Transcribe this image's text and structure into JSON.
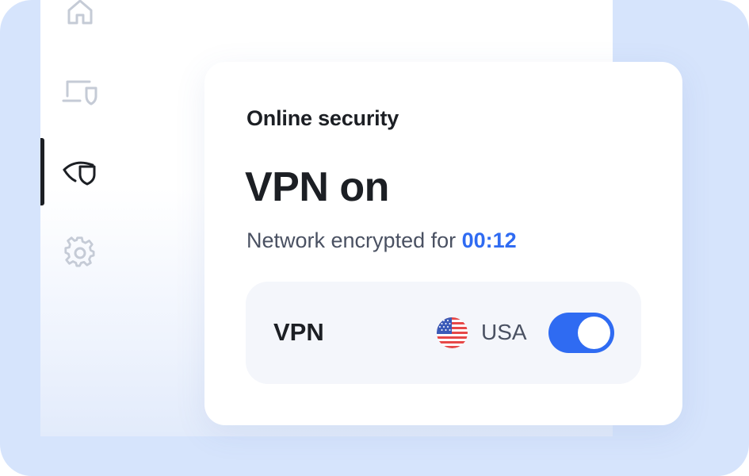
{
  "nav": {
    "items": [
      {
        "name": "home",
        "icon": "home-icon",
        "active": false
      },
      {
        "name": "device-security",
        "icon": "laptop-shield-icon",
        "active": false
      },
      {
        "name": "online-security",
        "icon": "eye-shield-icon",
        "active": true
      },
      {
        "name": "settings",
        "icon": "gear-icon",
        "active": false
      }
    ]
  },
  "card": {
    "eyebrow": "Online security",
    "title": "VPN on",
    "subtitle_prefix": "Network encrypted for ",
    "timer": "00:12"
  },
  "vpn_row": {
    "label": "VPN",
    "country": "USA",
    "flag_icon": "usa-flag-icon",
    "toggle_on": true
  },
  "colors": {
    "accent": "#2f6bf2",
    "background": "#d6e4fc",
    "text_primary": "#1c1f24",
    "text_secondary": "#4a5162",
    "icon_inactive": "#c5cbd6"
  }
}
